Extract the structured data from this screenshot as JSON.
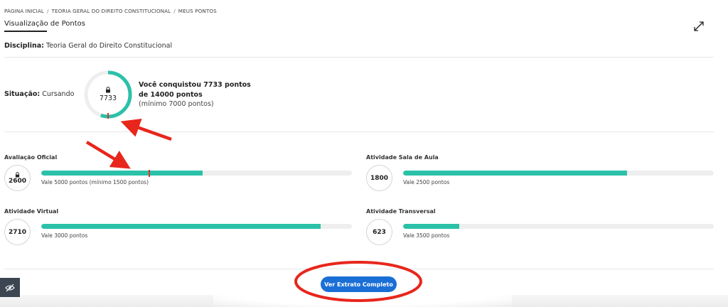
{
  "breadcrumb": {
    "items": [
      "PÁGINA INICIAL",
      "TEORIA GERAL DO DIREITO CONSTITUCIONAL",
      "MEUS PONTOS"
    ],
    "separator": "/"
  },
  "page": {
    "title": "Visualização de Pontos"
  },
  "discipline": {
    "label": "Disciplina:",
    "value": "Teoria Geral do Direito Constitucional"
  },
  "situation": {
    "label": "Situação:",
    "value": "Cursando"
  },
  "total": {
    "points": "7733",
    "points_value": 7733,
    "max_value": 14000,
    "min_value": 7000,
    "line1": "Você conquistou 7733 pontos",
    "line2": "de 14000 pontos",
    "line3": "(mínimo 7000 pontos)",
    "locked": true
  },
  "activities": [
    {
      "label": "Avaliação Oficial",
      "points": "2600",
      "points_value": 2600,
      "max_value": 5000,
      "min_value": 1500,
      "note": "Vale 5000 pontos (mínimo 1500 pontos)",
      "locked": true,
      "fill_fraction": 0.52
    },
    {
      "label": "Atividade Sala de Aula",
      "points": "1800",
      "points_value": 1800,
      "max_value": 2500,
      "note": "Vale 2500 pontos",
      "locked": false,
      "fill_fraction": 0.72
    },
    {
      "label": "Atividade Virtual",
      "points": "2710",
      "points_value": 2710,
      "max_value": 3000,
      "note": "Vale 3000 pontos",
      "locked": false,
      "fill_fraction": 0.9
    },
    {
      "label": "Atividade Transversal",
      "points": "623",
      "points_value": 623,
      "max_value": 3500,
      "note": "Vale 3500 pontos",
      "locked": false,
      "fill_fraction": 0.18
    }
  ],
  "actions": {
    "extract_label": "Ver Extrato Completo"
  },
  "icons": {
    "expand": "expand-arrows-icon",
    "lock": "lock-icon",
    "eye_off": "eye-off-icon"
  },
  "colors": {
    "progress_fill": "#2bc1a9",
    "progress_track": "#eeeeee",
    "marker": "#d9342b",
    "primary_button": "#1a6fd6",
    "annotation_red": "#e8261c"
  }
}
